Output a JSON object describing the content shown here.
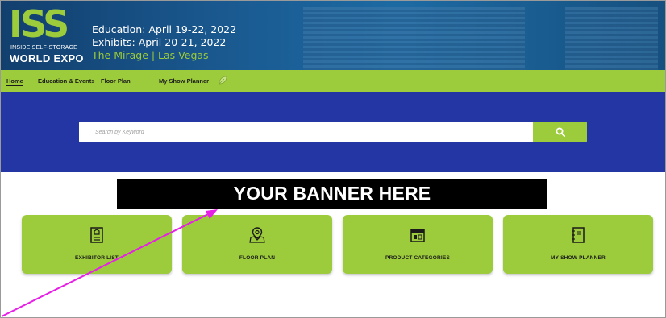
{
  "header": {
    "logo_main": "ISS",
    "logo_sub": "INSIDE SELF-STORAGE",
    "logo_bottom": "WORLD EXPO",
    "education_dates": "Education: April 19-22, 2022",
    "exhibit_dates": "Exhibits: April 20-21, 2022",
    "venue": "The Mirage | Las Vegas"
  },
  "nav": {
    "items": [
      {
        "label": "Home",
        "active": true
      },
      {
        "label": "Education & Events",
        "active": false
      },
      {
        "label": "Floor Plan",
        "active": false
      },
      {
        "label": "My Show Planner",
        "active": false
      }
    ]
  },
  "search": {
    "placeholder": "Search by Keyword",
    "value": "",
    "button_icon": "search-icon"
  },
  "banner": {
    "text": "YOUR BANNER HERE"
  },
  "tiles": [
    {
      "label": "EXHIBITOR LIST",
      "icon": "exhibitor-list-icon"
    },
    {
      "label": "FLOOR PLAN",
      "icon": "floor-plan-icon"
    },
    {
      "label": "PRODUCT CATEGORIES",
      "icon": "product-categories-icon"
    },
    {
      "label": "MY SHOW PLANNER",
      "icon": "show-planner-icon"
    }
  ],
  "colors": {
    "brand_green": "#9ccb3b",
    "band_blue": "#2336a3",
    "header_blue": "#1a5a91",
    "annotation_arrow": "#e61ee6"
  }
}
